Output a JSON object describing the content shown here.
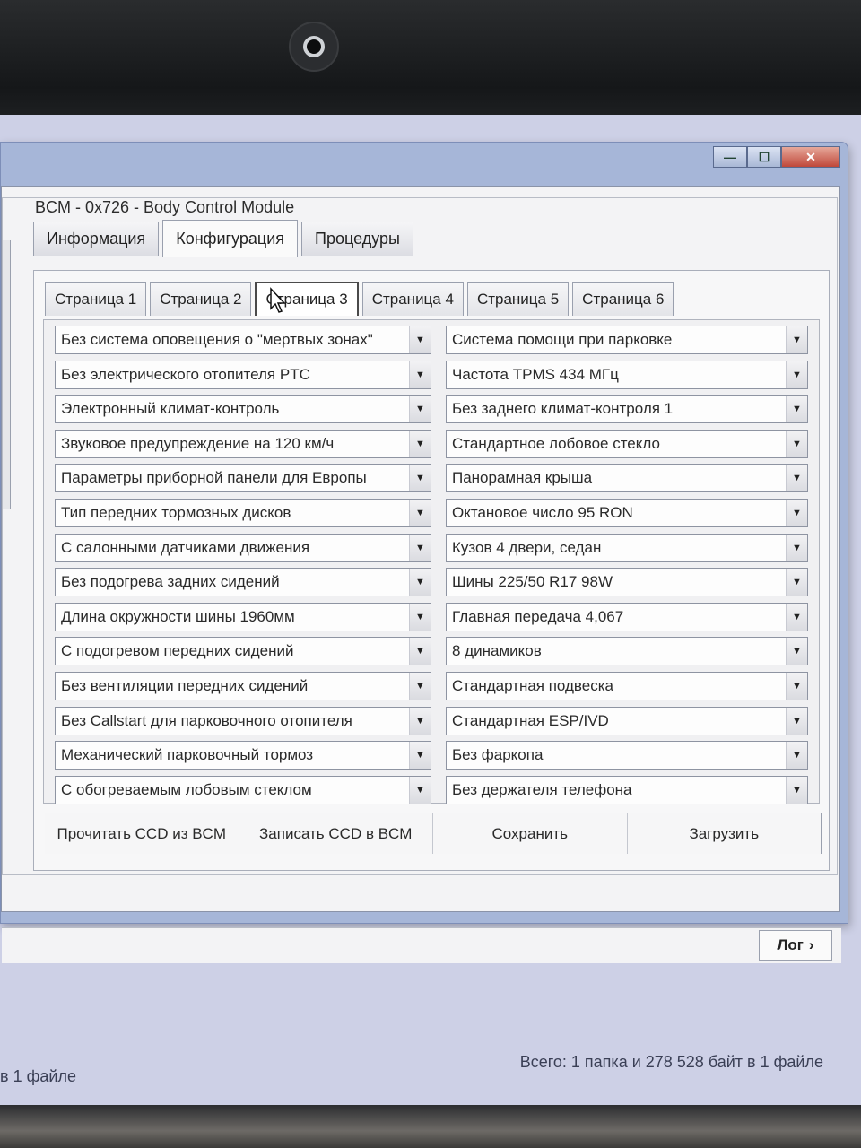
{
  "window": {
    "group_title": "BCM - 0x726 - Body Control Module",
    "controls": {
      "minimize": "—",
      "maximize": "☐",
      "close": "✕"
    }
  },
  "top_tabs": [
    {
      "label": "Информация",
      "active": false
    },
    {
      "label": "Конфигурация",
      "active": true
    },
    {
      "label": "Процедуры",
      "active": false
    }
  ],
  "page_tabs": [
    {
      "label": "Страница 1",
      "active": false
    },
    {
      "label": "Страница 2",
      "active": false
    },
    {
      "label": "Страница 3",
      "active": true
    },
    {
      "label": "Страница 4",
      "active": false
    },
    {
      "label": "Страница 5",
      "active": false
    },
    {
      "label": "Страница 6",
      "active": false
    }
  ],
  "left_fields": [
    "Без система оповещения о \"мертвых зонах\"",
    "Без электрического отопителя PTC",
    "Электронный климат-контроль",
    "Звуковое предупреждение на 120 км/ч",
    "Параметры приборной панели для Европы",
    "Тип передних тормозных дисков",
    "С салонными датчиками движения",
    "Без подогрева задних сидений",
    "Длина окружности шины 1960мм",
    "С подогревом передних сидений",
    "Без вентиляции передних сидений",
    "Без Callstart для парковочного отопителя",
    "Механический парковочный тормоз",
    "С обогреваемым лобовым стеклом"
  ],
  "right_fields": [
    "Система помощи при парковке",
    "Частота TPMS 434 МГц",
    "Без заднего климат-контроля 1",
    "Стандартное лобовое стекло",
    "Панорамная крыша",
    "Октановое число 95 RON",
    "Кузов 4 двери, седан",
    "Шины 225/50 R17 98W",
    "Главная передача 4,067",
    "8 динамиков",
    "Стандартная подвеска",
    "Стандартная ESP/IVD",
    "Без фаркопа",
    "Без держателя телефона"
  ],
  "actions": {
    "read": "Прочитать CCD из BCM",
    "write": "Записать CCD в BCM",
    "save": "Сохранить",
    "load": "Загрузить"
  },
  "log": {
    "label": "Лог",
    "chevron": "›"
  },
  "status": {
    "left": "в 1 файле",
    "right": "Всего: 1 папка и 278 528 байт в 1 файле"
  }
}
